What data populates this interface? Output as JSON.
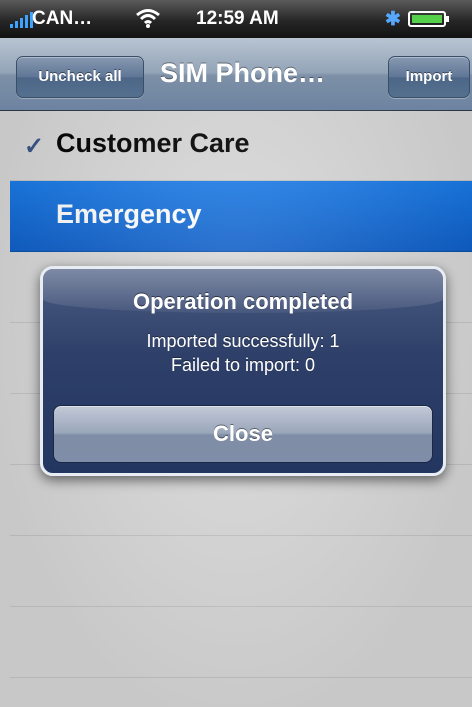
{
  "status_bar": {
    "carrier": "CAN…",
    "time": "12:59 AM",
    "signal_icon": "signal-bars-icon",
    "wifi_icon": "wifi-icon",
    "bluetooth_icon": "bluetooth-icon",
    "battery_icon": "battery-icon",
    "bluetooth_glyph": "✱"
  },
  "nav": {
    "left_button": "Uncheck all",
    "title": "SIM Phone…",
    "right_button": "Import"
  },
  "list": {
    "items": [
      {
        "label": "Customer Care",
        "checked": true,
        "selected": false
      },
      {
        "label": "Emergency",
        "checked": false,
        "selected": true
      }
    ],
    "check_glyph": "✓"
  },
  "alert": {
    "title": "Operation completed",
    "line1": "Imported successfully: 1",
    "line2": "Failed to import: 0",
    "button": "Close"
  },
  "colors": {
    "accent_blue": "#0d5ec8",
    "nav_bar": "#7d90a7",
    "alert_bg": "#2e4069"
  }
}
